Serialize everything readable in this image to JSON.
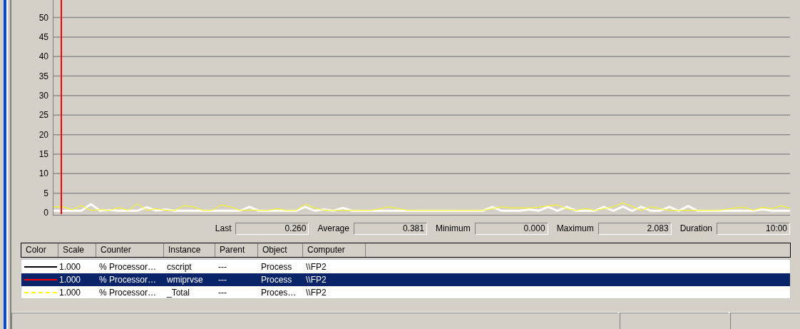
{
  "chart": {
    "chart_data": {
      "type": "line",
      "grid": true,
      "ylim": [
        0,
        54.5
      ],
      "yticks": [
        0,
        5,
        10,
        15,
        20,
        25,
        30,
        35,
        40,
        45,
        50
      ],
      "series": [
        {
          "color": "#ffffff",
          "values": [
            0.5,
            0.5,
            0.5,
            0.5,
            2.2,
            0.5,
            0.7,
            0.5,
            0.5,
            0.5,
            1.4,
            0.5,
            0.8,
            0.5,
            0.5,
            0.5,
            0.5,
            0.5,
            0.5,
            0.5,
            0.5,
            1.5,
            0.5,
            0.5,
            0.5,
            0.5,
            0.5,
            1.5,
            0.5,
            0.8,
            0.5,
            1.2,
            0.5,
            0.5,
            0.5,
            0.5,
            0.5,
            0.5,
            0.5,
            0.5,
            0.5,
            0.5,
            0.5,
            0.5,
            0.5,
            0.5,
            0.5,
            1.5,
            0.5,
            0.5,
            0.5,
            0.8,
            0.5,
            1.5,
            0.5,
            1.5,
            0.5,
            0.5,
            0.5,
            1.5,
            0.5,
            1.6,
            0.5,
            1.5,
            0.5,
            0.5,
            1.5,
            0.5,
            1.7,
            0.5,
            0.5,
            0.5,
            0.5,
            0.5,
            0.5,
            0.5,
            0.8,
            0.5,
            0.5,
            0.5
          ]
        },
        {
          "color": "#ffff00",
          "values": [
            1.5,
            1.5,
            0.8,
            1.8,
            0.6,
            0.8,
            0.6,
            1.3,
            0.6,
            2.3,
            0.6,
            1.0,
            0.6,
            0.6,
            1.8,
            1.5,
            0.6,
            0.6,
            2.0,
            1.5,
            0.6,
            0.7,
            0.6,
            0.6,
            1.0,
            0.6,
            0.6,
            2.2,
            1.2,
            0.6,
            0.6,
            0.6,
            0.6,
            0.6,
            0.6,
            1.0,
            1.5,
            1.0,
            0.6,
            0.6,
            0.6,
            0.6,
            0.6,
            0.6,
            0.6,
            0.6,
            0.6,
            1.0,
            1.5,
            1.2,
            1.2,
            1.2,
            1.4,
            1.8,
            2.0,
            1.0,
            0.6,
            1.0,
            0.6,
            1.0,
            1.5,
            2.5,
            1.6,
            0.6,
            1.5,
            1.0,
            0.6,
            0.6,
            0.6,
            0.6,
            0.6,
            0.6,
            0.8,
            1.2,
            1.4,
            0.6,
            1.4,
            1.0,
            1.8,
            1.0
          ]
        }
      ]
    }
  },
  "stats": [
    {
      "label": "Last",
      "value": "0.260"
    },
    {
      "label": "Average",
      "value": "0.381"
    },
    {
      "label": "Minimum",
      "value": "0.000"
    },
    {
      "label": "Maximum",
      "value": "2.083"
    },
    {
      "label": "Duration",
      "value": "10:00"
    }
  ],
  "legend": {
    "columns": [
      "Color",
      "Scale",
      "Counter",
      "Instance",
      "Parent",
      "Object",
      "Computer"
    ],
    "rows": [
      {
        "color": "#000000",
        "kind": "solid",
        "scale": "1.000",
        "counter": "% Processor…",
        "instance": "cscript",
        "parent": "---",
        "object": "Process",
        "computer": "\\\\FP2",
        "selected": false
      },
      {
        "color": "#ff0000",
        "kind": "solid",
        "scale": "1.000",
        "counter": "% Processor…",
        "instance": "wmiprvse",
        "parent": "---",
        "object": "Process",
        "computer": "\\\\FP2",
        "selected": true
      },
      {
        "color": "#ffff00",
        "kind": "dashed",
        "scale": "1.000",
        "counter": "% Processor…",
        "instance": "_Total",
        "parent": "---",
        "object": "Proces…",
        "computer": "\\\\FP2",
        "selected": false
      }
    ]
  }
}
